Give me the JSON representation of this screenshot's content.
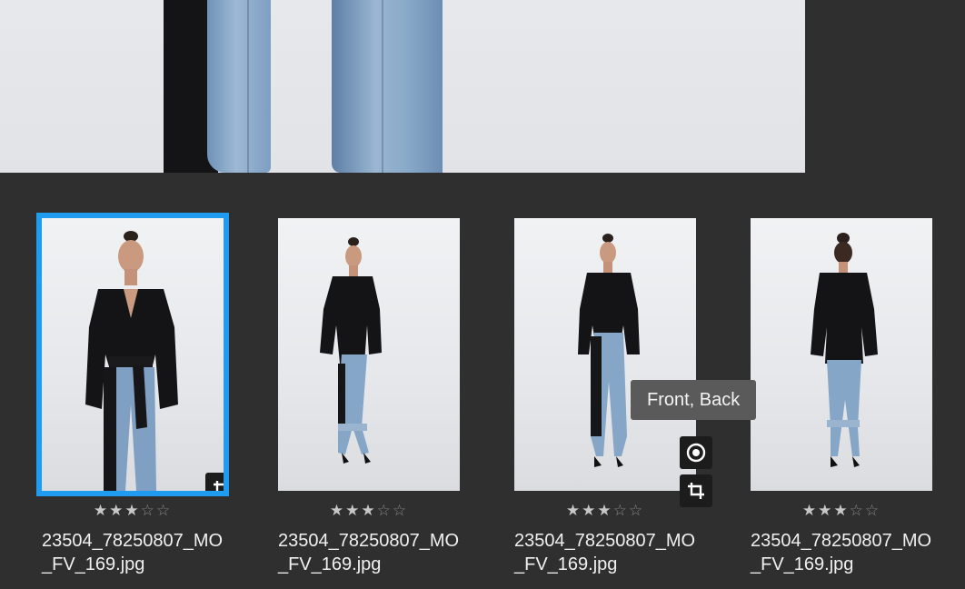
{
  "tooltip": {
    "text": "Front, Back"
  },
  "thumbnails": [
    {
      "filename": "23504_78250807_MO_FV_169.jpg",
      "rating": 3,
      "max_rating": 5,
      "selected": true
    },
    {
      "filename": "23504_78250807_MO_FV_169.jpg",
      "rating": 3,
      "max_rating": 5,
      "selected": false
    },
    {
      "filename": "23504_78250807_MO_FV_169.jpg",
      "rating": 3,
      "max_rating": 5,
      "selected": false
    },
    {
      "filename": "23504_78250807_MO_FV_169.jpg",
      "rating": 3,
      "max_rating": 5,
      "selected": false
    }
  ],
  "icons": {
    "crop": "crop-icon",
    "target": "target-icon"
  },
  "colors": {
    "selection": "#1f9bf0",
    "background": "#2f2f2f",
    "tooltip": "#5a5a5a"
  }
}
